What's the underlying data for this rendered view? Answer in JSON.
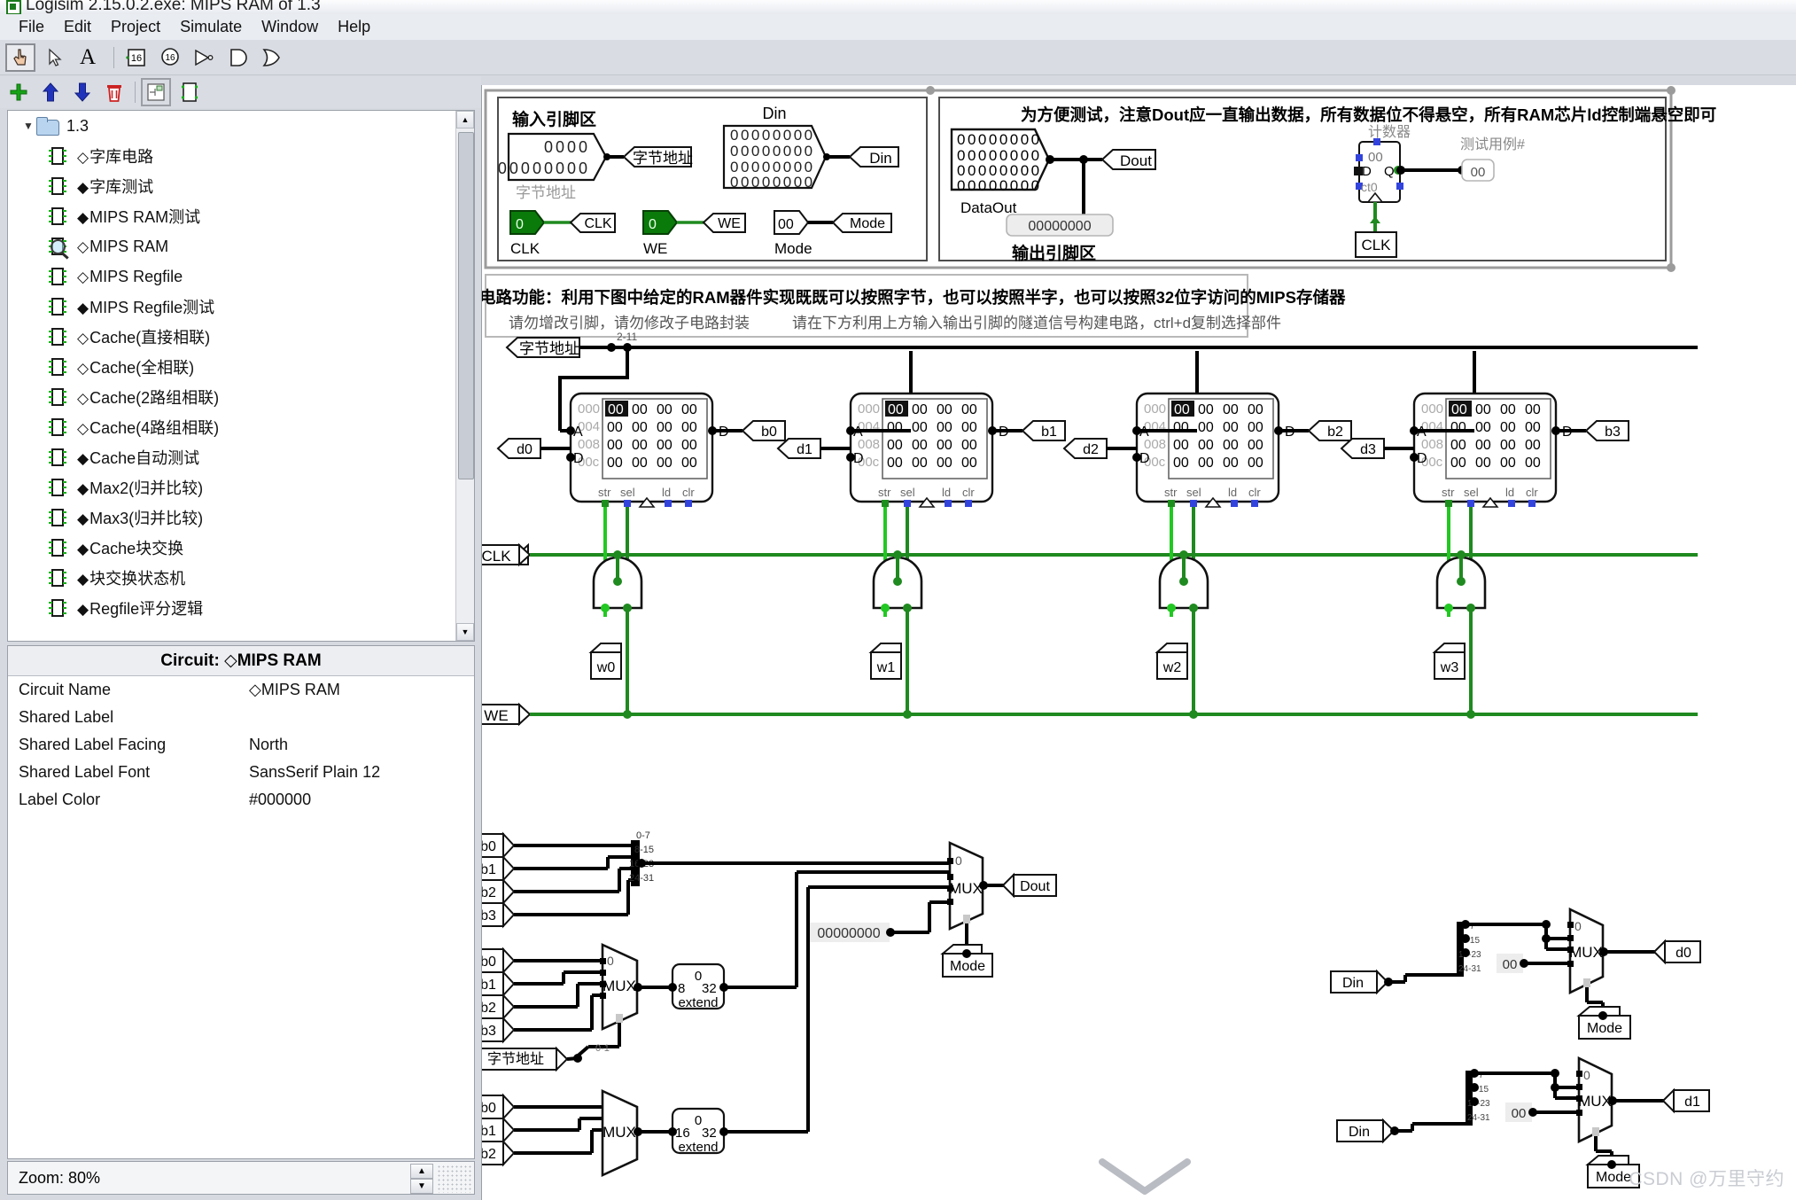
{
  "window": {
    "title": "Logisim 2.15.0.2.exe: MIPS RAM of 1.3",
    "app_icon": "logisim-icon"
  },
  "menubar": {
    "items": [
      "File",
      "Edit",
      "Project",
      "Simulate",
      "Window",
      "Help"
    ]
  },
  "toolbar": {
    "tools": [
      {
        "name": "poke-tool",
        "glyph": "☝",
        "selected": true
      },
      {
        "name": "select-tool",
        "glyph": "⬉",
        "selected": false
      },
      {
        "name": "text-tool",
        "glyph": "A",
        "selected": false
      },
      {
        "name": "separator",
        "glyph": "",
        "selected": false
      },
      {
        "name": "input-pin-tool",
        "glyph": "16",
        "selected": false
      },
      {
        "name": "output-pin-tool",
        "glyph": "16",
        "selected": false
      },
      {
        "name": "not-gate-tool",
        "glyph": "▷",
        "selected": false
      },
      {
        "name": "and-gate-tool",
        "glyph": "D",
        "selected": false
      },
      {
        "name": "or-gate-tool",
        "glyph": "D",
        "selected": false
      }
    ],
    "project_tools": [
      {
        "name": "add-circuit-button",
        "glyph": "＋"
      },
      {
        "name": "move-up-button",
        "glyph": "⬆"
      },
      {
        "name": "move-down-button",
        "glyph": "⬇"
      },
      {
        "name": "delete-circuit-button",
        "glyph": "🗑"
      },
      {
        "name": "view-toolbox-button",
        "glyph": "▣"
      },
      {
        "name": "view-simulation-button",
        "glyph": "▢"
      }
    ]
  },
  "explorer": {
    "root": {
      "label": "1.3",
      "expanded": true
    },
    "items": [
      {
        "marker": "◇",
        "label": "字库电路",
        "icon": "circuit-icon",
        "selected": false
      },
      {
        "marker": "◆",
        "label": "字库测试",
        "icon": "circuit-icon",
        "selected": false
      },
      {
        "marker": "◆",
        "label": "MIPS RAM测试",
        "icon": "circuit-icon",
        "selected": false
      },
      {
        "marker": "◇",
        "label": "MIPS RAM",
        "icon": "magnifier-icon",
        "selected": true
      },
      {
        "marker": "◇",
        "label": "MIPS Regfile",
        "icon": "circuit-icon",
        "selected": false
      },
      {
        "marker": "◆",
        "label": "MIPS Regfile测试",
        "icon": "circuit-icon",
        "selected": false
      },
      {
        "marker": "◇",
        "label": "Cache(直接相联)",
        "icon": "circuit-icon",
        "selected": false
      },
      {
        "marker": "◇",
        "label": "Cache(全相联)",
        "icon": "circuit-icon",
        "selected": false
      },
      {
        "marker": "◇",
        "label": "Cache(2路组相联)",
        "icon": "circuit-icon",
        "selected": false
      },
      {
        "marker": "◇",
        "label": "Cache(4路组相联)",
        "icon": "circuit-icon",
        "selected": false
      },
      {
        "marker": "◆",
        "label": "Cache自动测试",
        "icon": "circuit-icon",
        "selected": false
      },
      {
        "marker": "◆",
        "label": "Max2(归并比较)",
        "icon": "circuit-icon",
        "selected": false
      },
      {
        "marker": "◆",
        "label": "Max3(归并比较)",
        "icon": "circuit-icon",
        "selected": false
      },
      {
        "marker": "◆",
        "label": "Cache块交换",
        "icon": "circuit-icon",
        "selected": false
      },
      {
        "marker": "◆",
        "label": "块交换状态机",
        "icon": "circuit-icon",
        "selected": false
      },
      {
        "marker": "◆",
        "label": "Regfile评分逻辑",
        "icon": "circuit-icon",
        "selected": false
      }
    ]
  },
  "attributes": {
    "header": "Circuit: ◇MIPS RAM",
    "rows": [
      {
        "key": "Circuit Name",
        "value": "◇MIPS RAM"
      },
      {
        "key": "Shared Label",
        "value": ""
      },
      {
        "key": "Shared Label Facing",
        "value": "North"
      },
      {
        "key": "Shared Label Font",
        "value": "SansSerif Plain 12"
      },
      {
        "key": "Label Color",
        "value": "#000000"
      }
    ]
  },
  "statusbar": {
    "zoom": "Zoom: 80%"
  },
  "watermark": "CSDN @万里守约",
  "circuit": {
    "input_region": {
      "title": "输入引脚区",
      "byte_addr_value": [
        "0000",
        "00000000"
      ],
      "byte_addr_label": "字节地址",
      "byte_addr_tunnel": "字节地址",
      "din_title": "Din",
      "din_rows": [
        "00000000",
        "00000000",
        "00000000",
        "00000000"
      ],
      "din_tunnel": "Din",
      "clk_value": "0",
      "clk_label": "CLK",
      "clk_tunnel": "CLK",
      "we_value": "0",
      "we_label": "WE",
      "we_tunnel": "WE",
      "mode_value": "00",
      "mode_label": "Mode",
      "mode_tunnel": "Mode"
    },
    "output_region": {
      "title": "输出引脚区",
      "dataout_rows": [
        "00000000",
        "00000000",
        "00000000",
        "00000000"
      ],
      "dataout_label": "DataOut",
      "dout_tunnel": "Dout",
      "probe_value": "00000000",
      "note": "为方便测试，注意Dout应一直输出数据，所有数据位不得悬空，所有RAM芯片ld控制端悬空即可",
      "counter_label": "计数器",
      "counter_value": "00",
      "counter_pins": [
        "D",
        "Q",
        "ct0"
      ],
      "counter_clk": "CLK",
      "testcase_label": "测试用例#",
      "testcase_value": "00"
    },
    "description": {
      "line1": "电路功能：利用下图中给定的RAM器件实现既既可以按照字节，也可以按照半字，也可以按照32位字访问的MIPS存储器",
      "line2_left": "请勿增改引脚，请勿修改子电路封装",
      "line2_right": "请在下方利用上方输入输出引脚的隧道信号构建电路，ctrl+d复制选择部件"
    },
    "ram_bank": {
      "addr_tunnel": "字节地址",
      "addr_bits": "2-11",
      "chips": [
        {
          "data_in_tunnel": "d0",
          "data_out_tunnel": "b0",
          "addr_labels": [
            "000",
            "004",
            "008",
            "00c"
          ],
          "cells": [
            [
              "00",
              "00",
              "00",
              "00"
            ],
            [
              "00",
              "00",
              "00",
              "00"
            ],
            [
              "00",
              "00",
              "00",
              "00"
            ],
            [
              "00",
              "00",
              "00",
              "00"
            ]
          ],
          "pins_left": [
            "A",
            "D"
          ],
          "pin_right": "D",
          "pins_bottom": [
            "str",
            "sel",
            "ld",
            "clr"
          ]
        },
        {
          "data_in_tunnel": "d1",
          "data_out_tunnel": "b1",
          "addr_labels": [
            "000",
            "004",
            "008",
            "00c"
          ],
          "cells": [
            [
              "00",
              "00",
              "00",
              "00"
            ],
            [
              "00",
              "00",
              "00",
              "00"
            ],
            [
              "00",
              "00",
              "00",
              "00"
            ],
            [
              "00",
              "00",
              "00",
              "00"
            ]
          ],
          "pins_left": [
            "A",
            "D"
          ],
          "pin_right": "D",
          "pins_bottom": [
            "str",
            "sel",
            "ld",
            "clr"
          ]
        },
        {
          "data_in_tunnel": "d2",
          "data_out_tunnel": "b2",
          "addr_labels": [
            "000",
            "004",
            "008",
            "00c"
          ],
          "cells": [
            [
              "00",
              "00",
              "00",
              "00"
            ],
            [
              "00",
              "00",
              "00",
              "00"
            ],
            [
              "00",
              "00",
              "00",
              "00"
            ],
            [
              "00",
              "00",
              "00",
              "00"
            ]
          ],
          "pins_left": [
            "A",
            "D"
          ],
          "pin_right": "D",
          "pins_bottom": [
            "str",
            "sel",
            "ld",
            "clr"
          ]
        },
        {
          "data_in_tunnel": "d3",
          "data_out_tunnel": "b3",
          "addr_labels": [
            "000",
            "004",
            "008",
            "00c"
          ],
          "cells": [
            [
              "00",
              "00",
              "00",
              "00"
            ],
            [
              "00",
              "00",
              "00",
              "00"
            ],
            [
              "00",
              "00",
              "00",
              "00"
            ],
            [
              "00",
              "00",
              "00",
              "00"
            ]
          ],
          "pins_left": [
            "A",
            "D"
          ],
          "pin_right": "D",
          "pins_bottom": [
            "str",
            "sel",
            "ld",
            "clr"
          ]
        }
      ]
    },
    "write_logic": {
      "clk_tunnel": "CLK",
      "we_tunnel": "WE",
      "outputs": [
        "w0",
        "w1",
        "w2",
        "w3"
      ]
    },
    "read_mux": {
      "inputs": [
        "b0",
        "b1",
        "b2",
        "b3"
      ],
      "splitter_bits": [
        "0-7",
        "8-15",
        "16-23",
        "24-31"
      ],
      "mux_label": "MUX",
      "mux_top_index": "0",
      "const_value": "00000000",
      "select_tunnel": "Mode",
      "output_tunnel": "Dout"
    },
    "byte_mux": {
      "inputs": [
        "b0",
        "b1",
        "b2",
        "b3"
      ],
      "mux_label": "MUX",
      "mux_top_index": "0",
      "select_tunnel": "字节地址",
      "select_bits": "0-1",
      "extender": {
        "top": "0",
        "in_width": "8",
        "out_width": "32",
        "label": "extend"
      }
    },
    "half_mux": {
      "inputs": [
        "b0",
        "b1",
        "b2"
      ],
      "mux_label": "MUX",
      "extender": {
        "top": "0",
        "in_width": "16",
        "out_width": "32",
        "label": "extend"
      }
    },
    "write_mux_d0": {
      "source_tunnel": "Din",
      "splitter_bits": [
        "0-7",
        "8-15",
        "16-23",
        "24-31"
      ],
      "mux_label": "MUX",
      "mux_top_index": "0",
      "const_value": "00",
      "select_tunnel": "Mode",
      "output_tunnel": "d0"
    },
    "write_mux_d1": {
      "source_tunnel": "Din",
      "splitter_bits": [
        "0-7",
        "8-15",
        "16-23",
        "24-31"
      ],
      "mux_label": "MUX",
      "mux_top_index": "0",
      "const_value": "00",
      "select_tunnel": "Mode",
      "output_tunnel": "d1"
    },
    "colors": {
      "wire_black": "#000000",
      "wire_green_low": "#1f8a1f",
      "wire_green_high": "#33dd33",
      "pin_green": "#117711",
      "tunnel_fill": "#ffffff"
    }
  }
}
